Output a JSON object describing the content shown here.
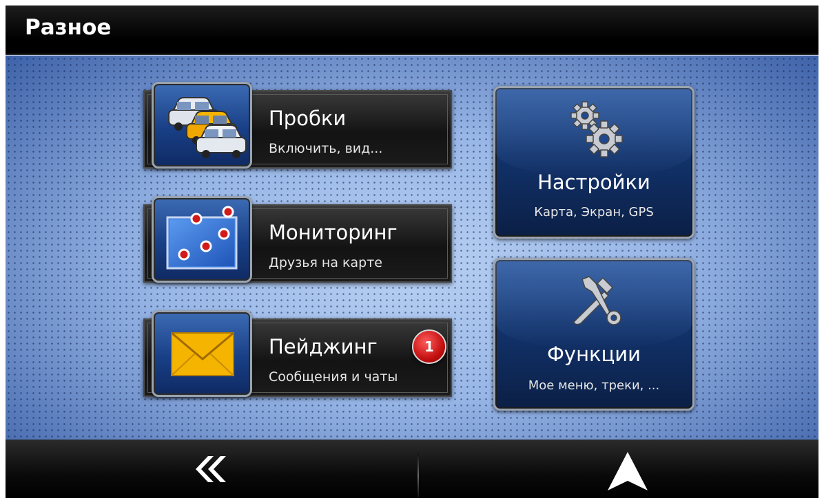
{
  "header": {
    "title": "Разное"
  },
  "menu": {
    "traffic": {
      "label": "Пробки",
      "sub": "Включить, вид..."
    },
    "monitoring": {
      "label": "Мониторинг",
      "sub": "Друзья на карте"
    },
    "paging": {
      "label": "Пейджинг",
      "sub": "Сообщения и чаты",
      "badge": "1"
    },
    "settings": {
      "label": "Настройки",
      "sub": "Карта, Экран, GPS"
    },
    "functions": {
      "label": "Функции",
      "sub": "Мое меню, треки, ..."
    }
  },
  "footer": {
    "back_icon": "double-chevron-left-icon",
    "navigate_icon": "navigation-arrow-icon"
  },
  "colors": {
    "accent_blue": "#1f4a90",
    "badge_red": "#c41010",
    "envelope_yellow": "#f5b400"
  }
}
